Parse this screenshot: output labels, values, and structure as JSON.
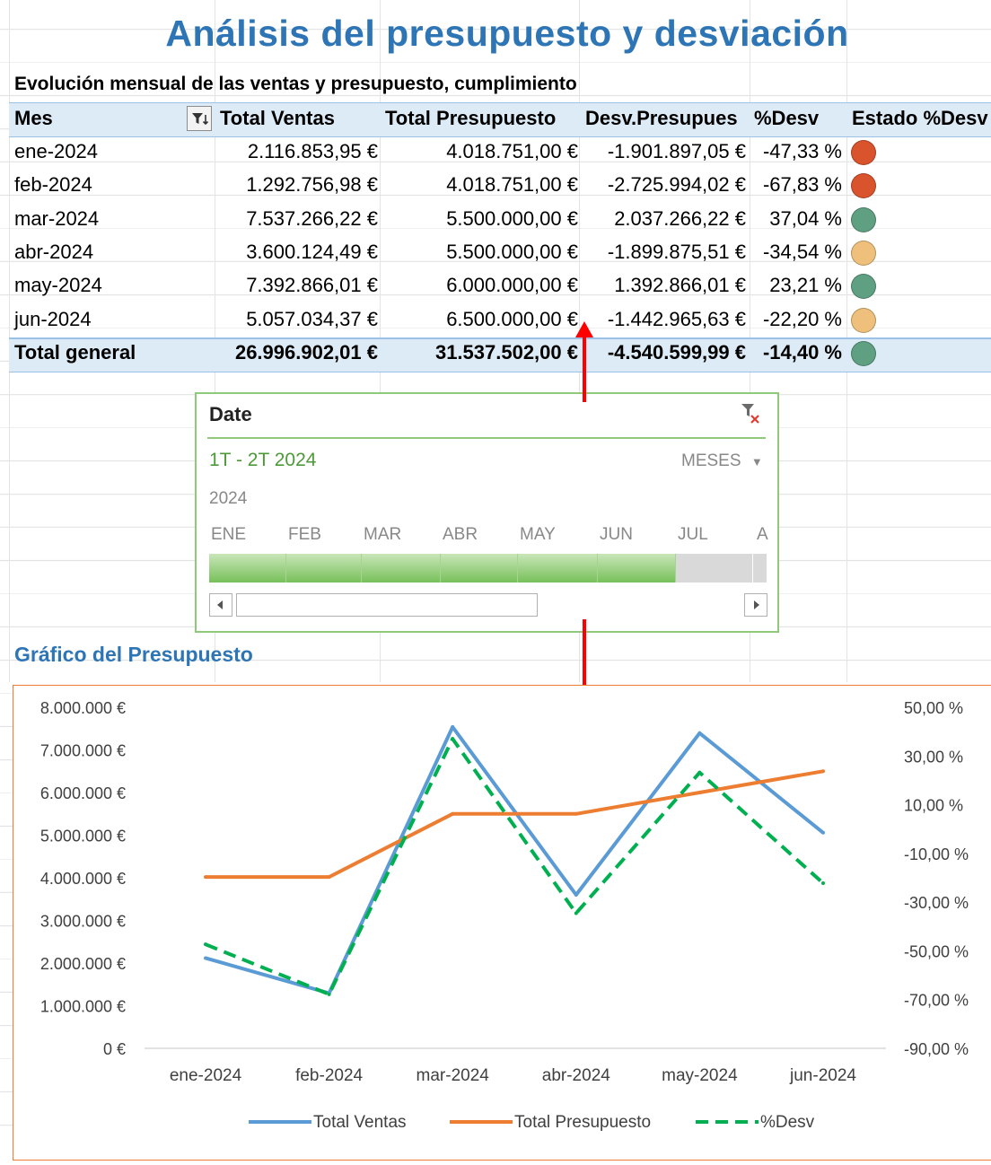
{
  "title": "Análisis del presupuesto y desviación",
  "subtitle": "Evolución mensual de las ventas y presupuesto, cumplimiento",
  "table": {
    "headers": {
      "mes": "Mes",
      "ventas": "Total Ventas",
      "presupuesto": "Total Presupuesto",
      "desv": "Desv.Presupues",
      "pct": "%Desv",
      "estado": "Estado %Desv"
    },
    "rows": [
      {
        "mes": "ene-2024",
        "ventas": "2.116.853,95 €",
        "presupuesto": "4.018.751,00 €",
        "desv": "-1.901.897,05 €",
        "pct": "-47,33 %",
        "status_color": "#d9532c"
      },
      {
        "mes": "feb-2024",
        "ventas": "1.292.756,98 €",
        "presupuesto": "4.018.751,00 €",
        "desv": "-2.725.994,02 €",
        "pct": "-67,83 %",
        "status_color": "#d9532c"
      },
      {
        "mes": "mar-2024",
        "ventas": "7.537.266,22 €",
        "presupuesto": "5.500.000,00 €",
        "desv": "2.037.266,22 €",
        "pct": "37,04 %",
        "status_color": "#5fa083"
      },
      {
        "mes": "abr-2024",
        "ventas": "3.600.124,49 €",
        "presupuesto": "5.500.000,00 €",
        "desv": "-1.899.875,51 €",
        "pct": "-34,54 %",
        "status_color": "#eec07b"
      },
      {
        "mes": "may-2024",
        "ventas": "7.392.866,01 €",
        "presupuesto": "6.000.000,00 €",
        "desv": "1.392.866,01 €",
        "pct": "23,21 %",
        "status_color": "#5fa083"
      },
      {
        "mes": "jun-2024",
        "ventas": "5.057.034,37 €",
        "presupuesto": "6.500.000,00 €",
        "desv": "-1.442.965,63 €",
        "pct": "-22,20 %",
        "status_color": "#eec07b"
      }
    ],
    "total": {
      "mes": "Total general",
      "ventas": "26.996.902,01 €",
      "presupuesto": "31.537.502,00 €",
      "desv": "-4.540.599,99 €",
      "pct": "-14,40 %",
      "status_color": "#5fa083"
    }
  },
  "timeline": {
    "title": "Date",
    "range": "1T - 2T 2024",
    "level": "MESES",
    "year": "2024",
    "months": [
      "ENE",
      "FEB",
      "MAR",
      "ABR",
      "MAY",
      "JUN",
      "JUL",
      "A"
    ],
    "selected_count": 6,
    "accent": "#8fc97a"
  },
  "chart_title": "Gráfico del Presupuesto",
  "chart_data": {
    "type": "line",
    "categories": [
      "ene-2024",
      "feb-2024",
      "mar-2024",
      "abr-2024",
      "may-2024",
      "jun-2024"
    ],
    "series": [
      {
        "name": "Total Ventas",
        "axis": "left",
        "color": "#5b9bd5",
        "style": "solid",
        "values": [
          2116853.95,
          1292756.98,
          7537266.22,
          3600124.49,
          7392866.01,
          5057034.37
        ]
      },
      {
        "name": "Total Presupuesto",
        "axis": "left",
        "color": "#ed7d31",
        "style": "solid",
        "values": [
          4018751,
          4018751,
          5500000,
          5500000,
          6000000,
          6500000
        ]
      },
      {
        "name": "%Desv",
        "axis": "right",
        "color": "#00b050",
        "style": "dashed",
        "values": [
          -47.33,
          -67.83,
          37.04,
          -34.54,
          23.21,
          -22.2
        ]
      }
    ],
    "left_axis": {
      "min": 0,
      "max": 8000000,
      "step": 1000000,
      "ticks": [
        "0 €",
        "1.000.000 €",
        "2.000.000 €",
        "3.000.000 €",
        "4.000.000 €",
        "5.000.000 €",
        "6.000.000 €",
        "7.000.000 €",
        "8.000.000 €"
      ]
    },
    "right_axis": {
      "min": -90,
      "max": 50,
      "step": 20,
      "ticks": [
        "-90,00 %",
        "-70,00 %",
        "-50,00 %",
        "-30,00 %",
        "-10,00 %",
        "10,00 %",
        "30,00 %",
        "50,00 %"
      ]
    },
    "legend_position": "bottom",
    "grid": false
  }
}
